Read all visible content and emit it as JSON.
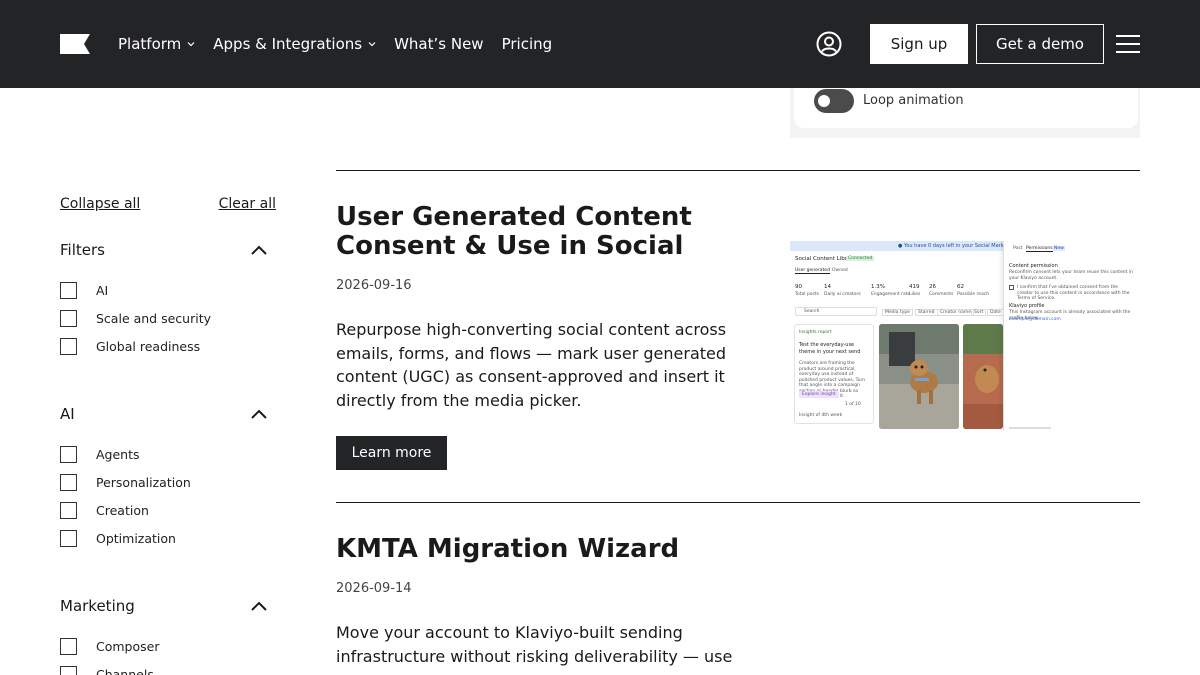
{
  "nav": {
    "logo_alt": "Klaviyo",
    "links": [
      {
        "label": "Platform",
        "has_dropdown": true
      },
      {
        "label": "Apps & Integrations",
        "has_dropdown": true
      },
      {
        "label": "What’s New",
        "has_dropdown": false
      },
      {
        "label": "Pricing",
        "has_dropdown": false
      }
    ],
    "signup_label": "Sign up",
    "demo_label": "Get a demo",
    "icons": {
      "account": "account-circle-icon",
      "menu": "hamburger-menu-icon"
    }
  },
  "prev_card": {
    "toggle_label": "Loop animation",
    "toggle_on": false
  },
  "sidebar": {
    "collapse_all": "Collapse all",
    "clear_all": "Clear all",
    "groups": [
      {
        "title": "Filters",
        "expanded": true,
        "options": [
          "AI",
          "Scale and security",
          "Global readiness"
        ]
      },
      {
        "title": "AI",
        "expanded": true,
        "options": [
          "Agents",
          "Personalization",
          "Creation",
          "Optimization"
        ]
      },
      {
        "title": "Marketing",
        "expanded": true,
        "options": [
          "Composer",
          "Channels"
        ]
      }
    ]
  },
  "entries": [
    {
      "title": "User Generated Content Consent & Use in Social",
      "date": "2026-09-16",
      "description": "Repurpose high-converting social content across emails, forms, and flows — mark user generated content (UGC) as consent-approved and insert it directly from the media picker.",
      "button_label": "Learn more"
    },
    {
      "title": "KMTA Migration Wizard",
      "date": "2026-09-14",
      "description": "Move your account to Klaviyo-built sending infrastructure without risking deliverability — use"
    }
  ],
  "screenshot": {
    "banner": "You have 0 days left in your Social Marketing free trial",
    "library_title": "Social Content Library",
    "library_badge": "Connected",
    "tabs": [
      "User generated",
      "Owned"
    ],
    "stats": [
      {
        "value": "90",
        "label": "Total posts"
      },
      {
        "value": "14",
        "label": "Daily ai creators"
      },
      {
        "value": "1.3%",
        "label": "Engagement rate"
      },
      {
        "value": "419",
        "label": "Likes"
      },
      {
        "value": "26",
        "label": "Comments"
      },
      {
        "value": "62",
        "label": "Possible reach"
      }
    ],
    "search_placeholder": "Search",
    "filters": [
      "Media type",
      "Starred",
      "Creator name",
      "Sort",
      "Date"
    ],
    "insight_badge": "Insights report",
    "insight_title": "Test the everyday-use theme in your next send",
    "insight_text": "Creators are framing the product around practical, everyday use instead of polished product values. Turn that angle into a campaign section or header blurb so shoppers can see it.",
    "insight_button": "Explore insight",
    "insight_pager": "1 of 10",
    "insight_note": "Insight of 4th week",
    "panel_tabs": [
      "Post",
      "Permissions",
      "New"
    ],
    "panel_section": "Content permission",
    "panel_text": "Reconfirm consent lets your team reuse this content in your Klaviyo account.",
    "panel_check": "I confirm that I've obtained consent from the creator to use this content in accordance with the Terms of Service.",
    "panel_profile_title": "Klaviyo profile",
    "panel_profile_text": "This Instagram account is already associated with the profile below.",
    "panel_email": "example@domain.com"
  },
  "colors": {
    "nav_bg": "#232426",
    "text": "#1a1a1a",
    "button_dark": "#232426",
    "toggle_off": "#4b4b4b",
    "banner_bg": "#dbe8fa",
    "link_blue": "#3367d6"
  }
}
